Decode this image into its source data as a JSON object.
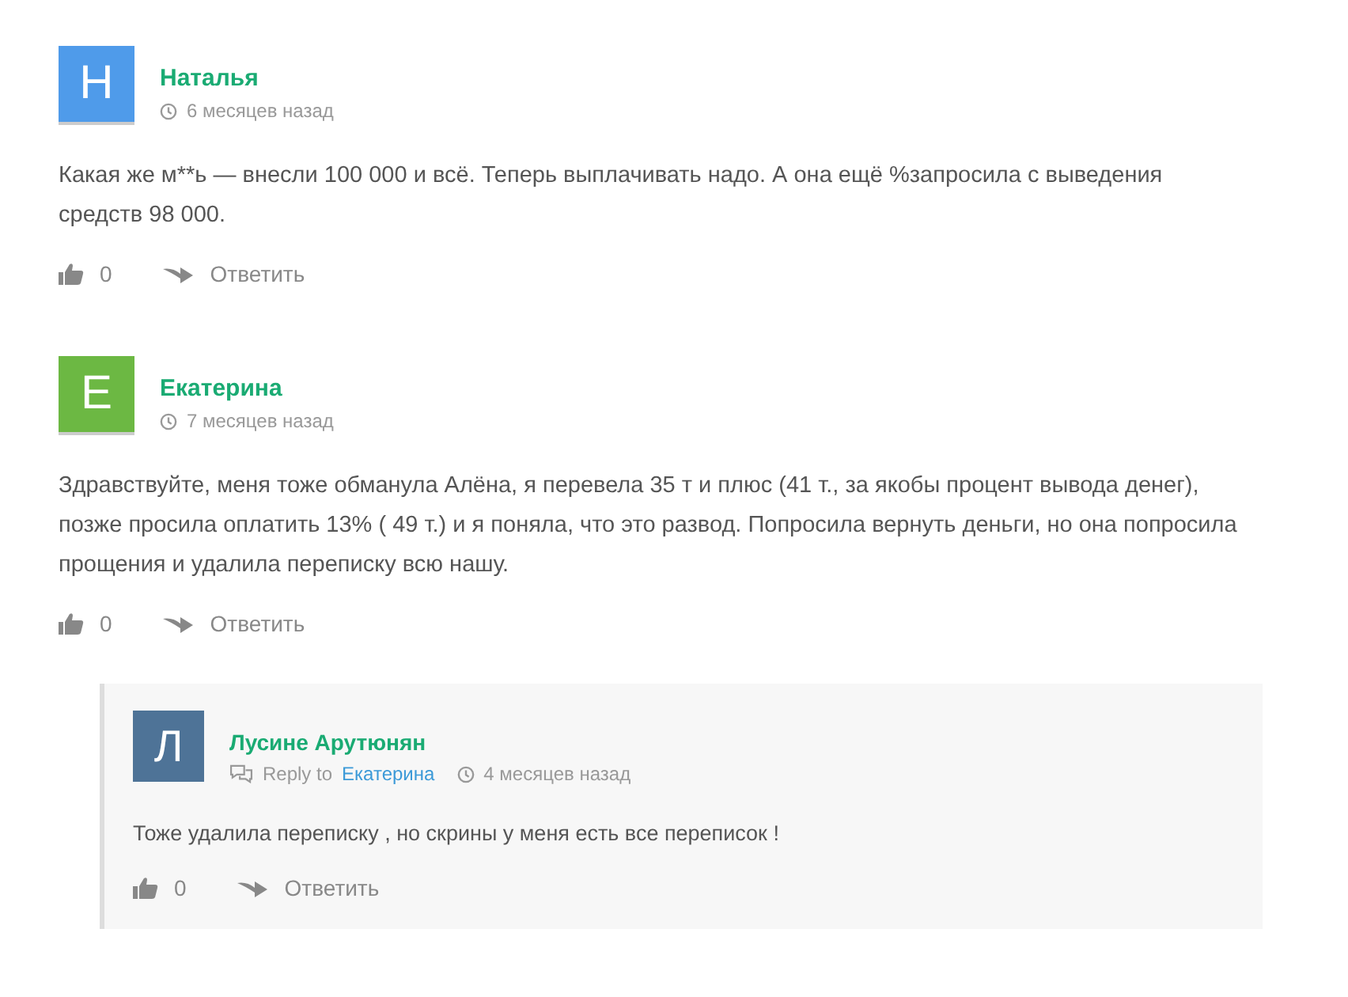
{
  "comments": [
    {
      "initial": "Н",
      "color": "#4f9bea",
      "author": "Наталья",
      "time": "6 месяцев назад",
      "text": "Какая же м**ь — внесли 100 000 и всё. Теперь выплачивать надо. А она ещё %запросила с выведения средств 98 000.",
      "likes": "0",
      "reply_button": "Ответить"
    },
    {
      "initial": "Е",
      "color": "#6cb843",
      "author": "Екатерина",
      "time": "7 месяцев назад",
      "text": "Здравствуйте, меня тоже обманула Алёна, я перевела 35 т и плюс (41 т., за якобы процент вывода денег), позже просила оплатить 13% ( 49 т.) и я поняла, что это развод. Попросила вернуть деньги, но она попросила прощения и удалила переписку всю нашу.",
      "likes": "0",
      "reply_button": "Ответить",
      "children": [
        {
          "initial": "Л",
          "color": "#4e7397",
          "author": "Лусине Арутюнян",
          "reply_label": "Reply to",
          "reply_to": "Екатерина",
          "time": "4 месяцев назад",
          "text": "Тоже удалила переписку , но скрины у меня есть все переписок !",
          "likes": "0",
          "reply_button": "Ответить"
        }
      ]
    }
  ]
}
